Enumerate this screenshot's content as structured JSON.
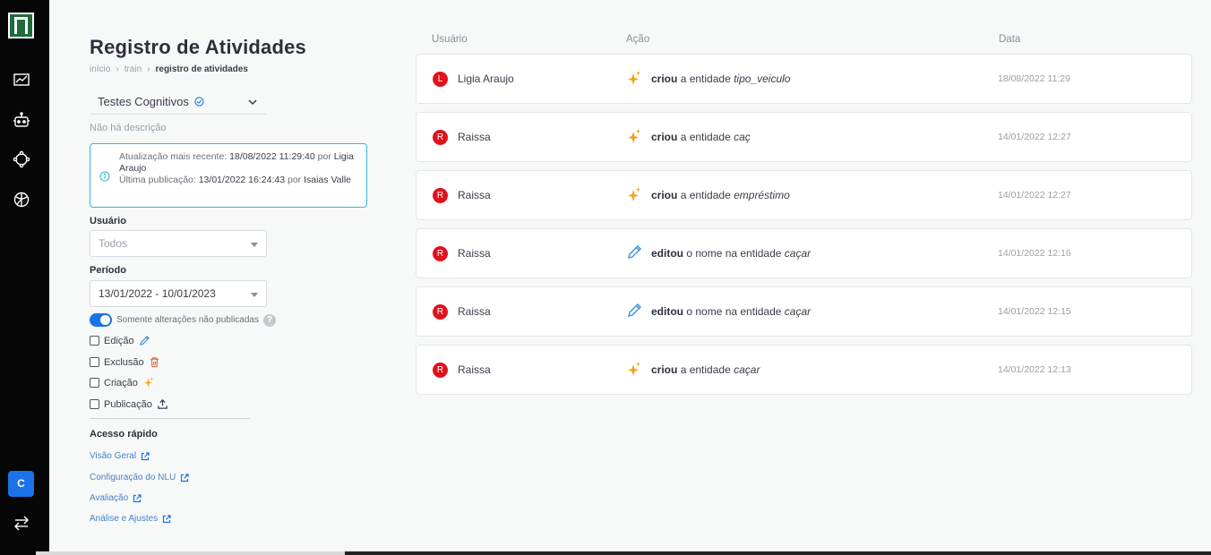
{
  "sidebar": {
    "avatar_letter": "C",
    "icons": [
      "chart-icon",
      "robot-icon",
      "network-icon",
      "globe-icon",
      "swap-icon"
    ]
  },
  "page": {
    "title": "Registro de Atividades",
    "breadcrumb": [
      "início",
      "train",
      "registro de atividades"
    ]
  },
  "bot_select": {
    "value": "Testes Cognitivos"
  },
  "description": "Não há descrição",
  "info": {
    "updated_label": "Atualização mais recente:",
    "updated_value": "18/08/2022 11:29:40",
    "by1": "por",
    "updated_user": "Ligia Araujo",
    "published_label": "Última publicação:",
    "published_value": "13/01/2022 16:24:43",
    "by2": "por",
    "published_user": "Isaias Valle"
  },
  "filters": {
    "user_label": "Usuário",
    "user_value": "Todos",
    "period_label": "Período",
    "period_value": "13/01/2022 - 10/01/2023",
    "toggle_label": "Somente alterações não publicadas",
    "toggle_on": true,
    "help": "?",
    "checkboxes": [
      {
        "label": "Edição",
        "checked": false
      },
      {
        "label": "Exclusão",
        "checked": false
      },
      {
        "label": "Criação",
        "checked": false
      },
      {
        "label": "Publicação",
        "checked": false
      }
    ]
  },
  "quick_access": {
    "title": "Acesso rápido",
    "links": [
      "Visão Geral",
      "Configuração do NLU",
      "Avaliação",
      "Análise e Ajustes"
    ]
  },
  "table": {
    "headers": [
      "Usuário",
      "Ação",
      "Data"
    ],
    "rows": [
      {
        "initial": "L",
        "user": "Ligia Araujo",
        "icon": "sparkle-icon",
        "verb": "criou",
        "text": "a entidade",
        "entity": "tipo_veiculo",
        "date": "18/08/2022 11:29"
      },
      {
        "initial": "R",
        "user": "Raissa",
        "icon": "sparkle-icon",
        "verb": "criou",
        "text": "a entidade",
        "entity": "caç",
        "date": "14/01/2022 12:27"
      },
      {
        "initial": "R",
        "user": "Raissa",
        "icon": "sparkle-icon",
        "verb": "criou",
        "text": "a entidade",
        "entity": "empréstimo",
        "date": "14/01/2022 12:27"
      },
      {
        "initial": "R",
        "user": "Raissa",
        "icon": "pencil-icon",
        "verb": "editou",
        "text": "o nome na entidade",
        "entity": "caçar",
        "date": "14/01/2022 12:16"
      },
      {
        "initial": "R",
        "user": "Raissa",
        "icon": "pencil-icon",
        "verb": "editou",
        "text": "o nome na entidade",
        "entity": "caçar",
        "date": "14/01/2022 12:15"
      },
      {
        "initial": "R",
        "user": "Raissa",
        "icon": "sparkle-icon",
        "verb": "criou",
        "text": "a entidade",
        "entity": "caçar",
        "date": "14/01/2022 12:13"
      }
    ]
  },
  "colors": {
    "accent": "#1a73e8",
    "badge": "#e0121b",
    "sparkle": "#f2a31b",
    "pencil": "#3a8fd8",
    "info_border": "#3ab8d3"
  }
}
